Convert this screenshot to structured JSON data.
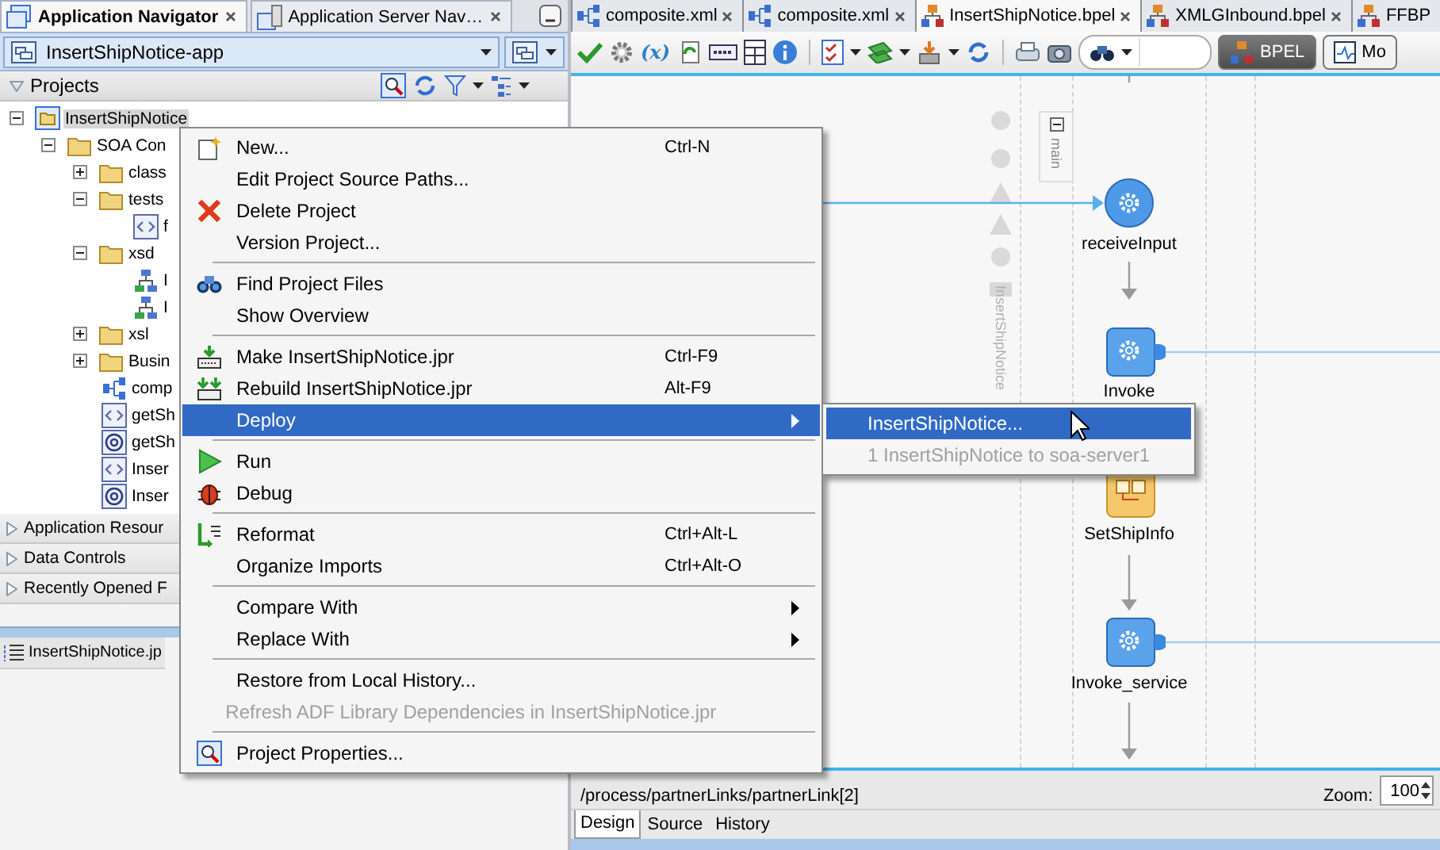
{
  "navigator": {
    "tabs": [
      {
        "label": "Application Navigator",
        "selected": true,
        "closable": true
      },
      {
        "label": "Application Server Nav…",
        "selected": false,
        "closable": true
      }
    ],
    "application": "InsertShipNotice-app",
    "projects_header": "Projects",
    "tree": [
      {
        "label": "InsertShipNotice",
        "kind": "project",
        "expanded": true,
        "selected": true,
        "children": [
          {
            "label": "SOA Con",
            "kind": "folder",
            "expanded": true,
            "selected": false,
            "children": [
              {
                "label": "class",
                "kind": "folder",
                "expanded": false,
                "selected": false
              },
              {
                "label": "tests",
                "kind": "folder",
                "expanded": true,
                "selected": false,
                "children": [
                  {
                    "label": "f",
                    "kind": "wsdl",
                    "selected": false
                  }
                ]
              },
              {
                "label": "xsd",
                "kind": "folder",
                "expanded": true,
                "selected": false,
                "children": [
                  {
                    "label": "I",
                    "kind": "schema",
                    "selected": false
                  },
                  {
                    "label": "I",
                    "kind": "schema",
                    "selected": false
                  }
                ]
              },
              {
                "label": "xsl",
                "kind": "folder",
                "expanded": false,
                "selected": false
              },
              {
                "label": "Busin",
                "kind": "folder",
                "expanded": false,
                "selected": false
              },
              {
                "label": "comp",
                "kind": "composite",
                "selected": false
              },
              {
                "label": "getSh",
                "kind": "wsdl",
                "selected": false
              },
              {
                "label": "getSh",
                "kind": "adapter",
                "selected": false
              },
              {
                "label": "Inser",
                "kind": "wsdl",
                "selected": false
              },
              {
                "label": "Inser",
                "kind": "adapter",
                "selected": false
              }
            ]
          }
        ]
      }
    ],
    "accordions": [
      {
        "label": "Application Resour",
        "expanded": false
      },
      {
        "label": "Data Controls",
        "expanded": false
      },
      {
        "label": "Recently Opened F",
        "expanded": false
      }
    ],
    "structure_tab": "InsertShipNotice.jp"
  },
  "editor": {
    "tabs": [
      {
        "label": "composite.xml",
        "kind": "composite",
        "selected": false,
        "closable": true
      },
      {
        "label": "composite.xml",
        "kind": "composite",
        "selected": false,
        "closable": true
      },
      {
        "label": "InsertShipNotice.bpel",
        "kind": "bpel",
        "selected": true,
        "closable": true
      },
      {
        "label": "XMLGInbound.bpel",
        "kind": "bpel",
        "selected": false,
        "closable": true
      },
      {
        "label": "FFBP",
        "kind": "bpel",
        "selected": false,
        "closable": false
      }
    ],
    "variables_button": "(x)",
    "view_buttons": [
      {
        "label": "BPEL",
        "selected": true
      },
      {
        "label": "Mo",
        "selected": false
      }
    ],
    "diagram": {
      "lane_label": "InsertShipNotice",
      "scope_label": "main",
      "scope_expanded": true,
      "nodes": [
        {
          "label": "receiveInput",
          "kind": "receive"
        },
        {
          "label": "Invoke",
          "kind": "invoke"
        },
        {
          "label": "SetShipInfo",
          "kind": "assign"
        },
        {
          "label": "Invoke_service",
          "kind": "invoke"
        }
      ]
    },
    "status_path": "/process/partnerLinks/partnerLink[2]",
    "zoom_label": "Zoom:",
    "zoom_value": "100",
    "bottom_tabs": [
      {
        "label": "Design",
        "selected": true
      },
      {
        "label": "Source",
        "selected": false
      },
      {
        "label": "History",
        "selected": false
      }
    ]
  },
  "context_menu": {
    "items": [
      {
        "kind": "item",
        "label": "New...",
        "shortcut": "Ctrl-N",
        "submenu": false,
        "selected": false,
        "disabled": false
      },
      {
        "kind": "item",
        "label": "Edit Project Source Paths...",
        "submenu": false,
        "selected": false,
        "disabled": false
      },
      {
        "kind": "item",
        "label": "Delete Project",
        "submenu": false,
        "selected": false,
        "disabled": false
      },
      {
        "kind": "item",
        "label": "Version Project...",
        "submenu": false,
        "selected": false,
        "disabled": false
      },
      {
        "kind": "separator"
      },
      {
        "kind": "item",
        "label": "Find Project Files",
        "submenu": false,
        "selected": false,
        "disabled": false
      },
      {
        "kind": "item",
        "label": "Show Overview",
        "submenu": false,
        "selected": false,
        "disabled": false
      },
      {
        "kind": "separator"
      },
      {
        "kind": "item",
        "label": "Make InsertShipNotice.jpr",
        "shortcut": "Ctrl-F9",
        "submenu": false,
        "selected": false,
        "disabled": false
      },
      {
        "kind": "item",
        "label": "Rebuild InsertShipNotice.jpr",
        "shortcut": "Alt-F9",
        "submenu": false,
        "selected": false,
        "disabled": false
      },
      {
        "kind": "item",
        "label": "Deploy",
        "submenu": true,
        "selected": true,
        "disabled": false
      },
      {
        "kind": "separator"
      },
      {
        "kind": "item",
        "label": "Run",
        "submenu": false,
        "selected": false,
        "disabled": false
      },
      {
        "kind": "item",
        "label": "Debug",
        "submenu": false,
        "selected": false,
        "disabled": false
      },
      {
        "kind": "separator"
      },
      {
        "kind": "item",
        "label": "Reformat",
        "shortcut": "Ctrl+Alt-L",
        "submenu": false,
        "selected": false,
        "disabled": false
      },
      {
        "kind": "item",
        "label": "Organize Imports",
        "shortcut": "Ctrl+Alt-O",
        "submenu": false,
        "selected": false,
        "disabled": false
      },
      {
        "kind": "separator"
      },
      {
        "kind": "item",
        "label": "Compare With",
        "submenu": true,
        "selected": false,
        "disabled": false
      },
      {
        "kind": "item",
        "label": "Replace With",
        "submenu": true,
        "selected": false,
        "disabled": false
      },
      {
        "kind": "separator"
      },
      {
        "kind": "item",
        "label": "Restore from Local History...",
        "submenu": false,
        "selected": false,
        "disabled": false
      },
      {
        "kind": "item",
        "label": "Refresh ADF Library Dependencies in InsertShipNotice.jpr",
        "submenu": false,
        "selected": false,
        "disabled": true
      },
      {
        "kind": "separator"
      },
      {
        "kind": "item",
        "label": "Project Properties...",
        "submenu": false,
        "selected": false,
        "disabled": false
      }
    ]
  },
  "submenu": {
    "items": [
      {
        "label": "InsertShipNotice...",
        "selected": true,
        "disabled": false
      },
      {
        "label": "1  InsertShipNotice to soa-server1",
        "selected": false,
        "disabled": true
      }
    ]
  }
}
